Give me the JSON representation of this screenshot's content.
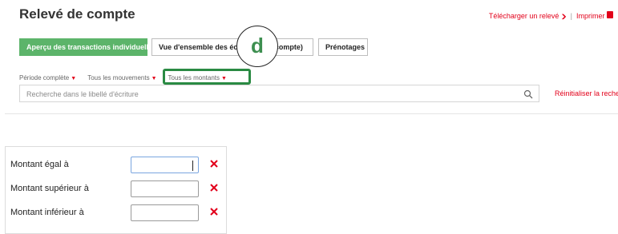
{
  "page": {
    "title": "Relevé de compte"
  },
  "header_links": {
    "download_label": "Télécharger un relevé",
    "separator": "|",
    "print_label": "Imprimer"
  },
  "tabs": [
    {
      "label": "Aperçu des transactions individuelles",
      "active": true
    },
    {
      "label": "Vue d'ensemble des écritures (de compte)",
      "active": false
    },
    {
      "label": "Prénotages",
      "active": false
    }
  ],
  "annotation": {
    "letter": "d"
  },
  "filters": {
    "period": "Période complète",
    "movements": "Tous les mouvements",
    "amounts": "Tous les montants"
  },
  "search": {
    "placeholder": "Recherche dans le libellé d'écriture",
    "value": "",
    "reset_label": "Réinitialiser la recherche"
  },
  "amount_filter": {
    "rows": [
      {
        "label": "Montant égal à",
        "value": "",
        "focused": true
      },
      {
        "label": "Montant supérieur à",
        "value": "",
        "focused": false
      },
      {
        "label": "Montant inférieur à",
        "value": "",
        "focused": false
      }
    ]
  },
  "colors": {
    "brand_red": "#e2001a",
    "active_tab_green": "#5cb46a",
    "highlight_green": "#2a8a43"
  },
  "icons": {
    "download_chevron": "chevron-down-icon",
    "print": "printer-icon",
    "filter_arrow": "caret-down-icon",
    "search": "magnifier-icon",
    "clear": "close-x-icon"
  }
}
